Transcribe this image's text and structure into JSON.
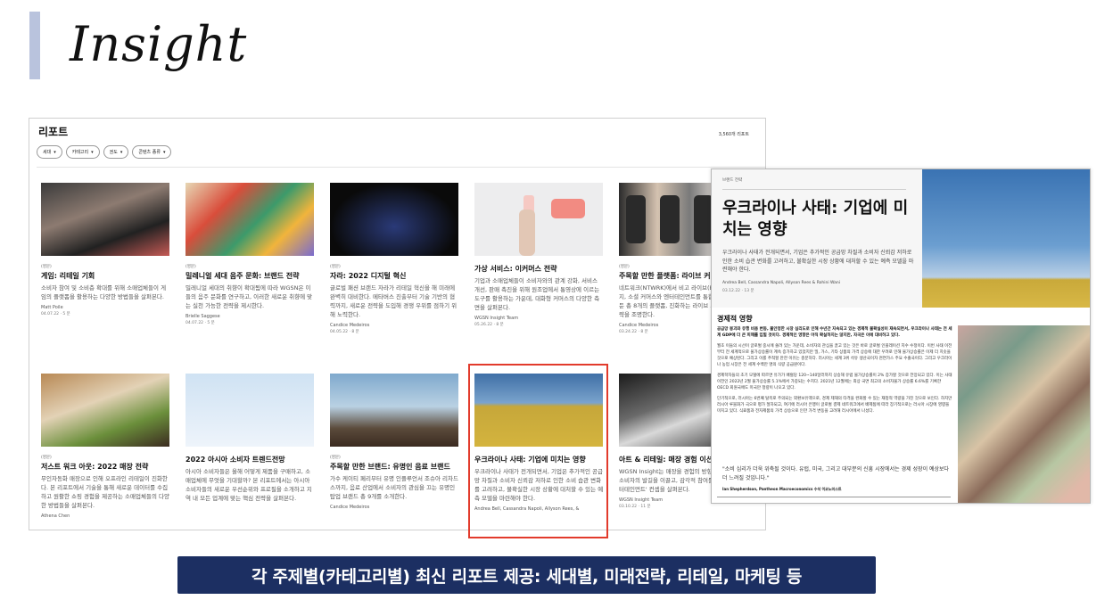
{
  "slide": {
    "title": "Insight",
    "caption": "각 주제별(카테고리별) 최신 리포트 제공: 세대별, 미래전략, 리테일, 마케팅 등"
  },
  "report": {
    "title": "리포트",
    "count": "3,560개 리포트",
    "filters": [
      {
        "label": "세대"
      },
      {
        "label": "카테고리"
      },
      {
        "label": "권도"
      },
      {
        "label": "콘텐츠 종류"
      }
    ],
    "cards": [
      {
        "tag": "(영문)",
        "title": "게임: 리테일 기회",
        "desc": "소비자 참여 및 소비층 확대를 위해 소매업체들이 게임의 플랫폼을 활용하는 다양한 방법들을 살펴본다.",
        "author": "Matt Poile",
        "date": "04.07.22 · 5 분"
      },
      {
        "tag": "(영문)",
        "title": "밀레니얼 세대 음주 문화: 브랜드 전략",
        "desc": "밀레니얼 세대의 취향이 확대됨에 따라 WGSN은 이들의 음주 문화를 연구하고, 이러한 새로운 취향에 맞는 실천 가능한 전략을 제시한다.",
        "author": "Brielle Saggese",
        "date": "04.07.22 · 5 분"
      },
      {
        "tag": "(영문)",
        "title": "자라: 2022 디지털 혁신",
        "desc": "글로벌 패션 브랜드 자라가 리테일 혁신을 해 미래에 완벽히 대비한다. 메타버스 진출부터 기술 기반의 협력까지, 새로운 전략을 도입해 경쟁 우위를 점하기 위해 노력한다.",
        "author": "Candice Medeiros",
        "date": "04.05.22 · 8 분"
      },
      {
        "tag": "",
        "title": "가상 서비스: 이커머스 전략",
        "desc": "기업과 소매업체들이 소비자와의 관계 강화, 서비스 개선, 판매 촉진을 위해 원조업에서 통영상에 이르는 도구를 활용하는 가운데, 대화형 커머스의 다양한 측면을 살펴본다.",
        "author": "WGSN Insight Team",
        "date": "05.26.22 · 8 분"
      },
      {
        "tag": "(영문)",
        "title": "주목할 만한 플랫폼: 라이브 커머스",
        "desc": "네트워크(NTWRK)에서 비고 라이브(Bigo Live)까지, 소셜 커머스와 엔터테인먼트를 통합해 성공을 거둔 총 8개의 플랫폼, 진화하는 라이브 스트림 쇼핑 전략을 조명한다.",
        "author": "Candice Medeiros",
        "date": "03.24.22 · 8 분"
      },
      {
        "tag": "(영문)",
        "title": "저스트 워크 아웃: 2022 매장 전략",
        "desc": "무인자동화 매장으로 인해 오프라인 리테일이 진화한다. 본 리포트에서 기술을 통해 새로운 데이터를 수집하고 원활한 쇼핑 경험을 제공하는 소매업체들의 다양한 방법들을 살펴본다.",
        "author": "Athena Chen",
        "date": ""
      },
      {
        "tag": "",
        "title": "2022 아시아 소비자 트렌드전망",
        "desc": "아시아 소비자들은 올해 어떻게 제품을 구매하고, 소매업체에 무엇을 기대할까? 본 리포트에서는 아시아 소비자들의 새로운 우선순위와 프로필을 소개하고 지역 내 모든 업계에 맞는 핵심 전략을 살펴본다.",
        "author": "",
        "date": ""
      },
      {
        "tag": "(영문)",
        "title": "주목할 만한 브랜드: 유명인 음료 브랜드",
        "desc": "가수 케이티 페리부터 유명 인플루언서 조슈아 리차드스까지, 음료 산업에서 소비자의 관심을 끄는 유명인 탑업 브랜드 총 9개를 소개한다.",
        "author": "Candice Medeiros",
        "date": ""
      },
      {
        "tag": "",
        "title": "우크라이나 사태: 기업에 미치는 영향",
        "desc": "우크라이나 사태가 전개되면서, 기업은 추가적인 공급망 차질과 소비자 신뢰감 저하로 인한 소비 습관 변화를 고려하고, 불확실한 시장 상황에 대처할 수 있는 예측 모델을 마련해야 한다.",
        "author": "Andrea Bell, Cassandra Napoli, Allyson Rees, &",
        "date": ""
      },
      {
        "tag": "",
        "title": "아트 & 리테일: 매장 경험 이션",
        "desc": "WGSN Insight는 매장을 경험의 방향으로 이끌고, 소비자의 발길을 이끌고, 감각적 참여를 유도하는 '엔터테인먼트' 컨셉을 살펴본다.",
        "author": "WGSN Insight Team",
        "date": "03.10.22 · 11 분"
      }
    ]
  },
  "article": {
    "category": "브랜드 전략",
    "title": "우크라이나 사태: 기업에 미치는 영향",
    "lead": "우크라이나 사태가 전개되면서, 기업은 추가적인 공급망 차질과 소비자 신뢰감 저하로 인한 소비 습관 변화를 고려하고, 불확실한 시장 상황에 대처할 수 있는 예측 모델을 마련해야 한다.",
    "authors": "Andrea Bell, Cassandra Napoli, Allyson Rees & Rohini Wani",
    "date": "03.12.22 · 13 분",
    "section": "경제적 영향",
    "body": [
      "공급망 붕괴와 유행 비용 변동, 불안정한 시장 심리도로 인해 수년간 지속되고 있는 경제적 불확실성이 재속되면서, 우크라이나 사태는 전 세계 GDP에 더 큰 피해를 입힐 것이다. 경제적인 영향은 아직 확실하지는 않지만, 자국은 이에 대비하고 있다.",
      "월초 이들의 시선이 글로벌 중시에 쏠려 있는 가운데, 소비자의 관심을 끌고 있는 것은 바로 글로벌 인플레이션 지수 수정이다. 이번 사태 이전부터 전 세계적으로 물가상승률이 계속 증가하고 있었지만 밀, 가스, 기타 상품의 가격 상승에 대한 우려로 인해 물가상승률은 이제 더 치솟을 것으로 예상된다. 그리고 이를 추적할 만한 이유는 충분하다. 러시아는 세계 3위 석유 생산국이자 천연가스 주요 수출국이다. 그리고 우크라이나 농업 시장은 전 세계 수백만 명의 식량 공급원이다.",
      "경제학자들의 초기 모델에 따르면 유가가 배럴당 120~140달러까지 상승해 유럽 물가상승률이 2% 증가할 것으로 전망되고 있다. 이는 사태 이전인 2022년 2월 물가상승률 5.1%에서 가중되는 수치다. 2021년 12월에는 최상 국면 최고의 소비자물가 상승률 6.6%를 기록한 OECD 회원국에도 미국만 정량이 나오고 있다.",
      "단기적으로, 러시아는 6번째 탈목로 주의되는 외환보유액으로, 경제 제재의 타격을 완화할 수 있는 재정적 역량을 가진 것으로 보인다. 하지만 러시아 루블화가 극으로 평가 절하되고, 여기에 러시아 은행이 글로벌 결제 네트워크에서 배제됨에 따라 장기적으로는 러시아 시장에 영향을 미치고 있다. 식료품과 전자제품의 가격 상승으로 인한 가격 변동을 고려해 러시아에서 나섰다."
    ],
    "quote": "\"소비 심리가 더욱 위축될 것이다. 유럽, 미국, 그리고 대부분의 신흥 시장에서는 경제 성장이 예상보다 더 느려질 것입니다.\"",
    "quote_source": "Ian Shepherdson, Pantheon Macroeconomics 수석 이코노미스트"
  },
  "colors": {
    "caption_bg": "#1c2f62",
    "highlight": "#e23b2c",
    "accent_bar": "#b9c3dd"
  }
}
